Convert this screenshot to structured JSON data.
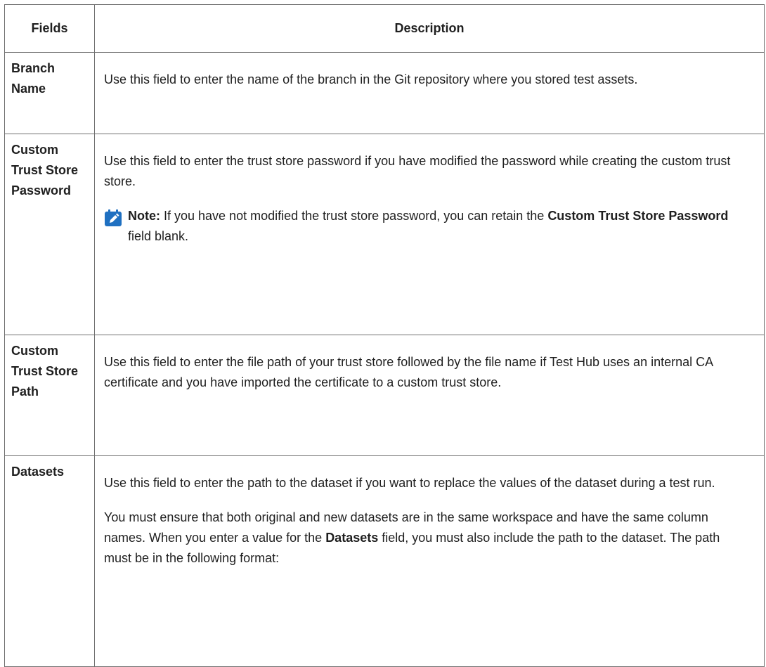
{
  "table": {
    "header": {
      "fields": "Fields",
      "description": "Description"
    },
    "rows": [
      {
        "field": "Branch Name",
        "p1": "Use this field to enter the name of the branch in the Git repository where you stored test assets."
      },
      {
        "field": "Custom Trust Store Pass­word",
        "p1": "Use this field to enter the trust store password if you have modified the password while creating the custom trust store.",
        "note": {
          "icon": "pencil-note-icon",
          "label": "Note:",
          "text_before": " If you have not modified the trust store password, you can retain the ",
          "bold": "Cus­tom Trust Store Password",
          "text_after": " field blank."
        }
      },
      {
        "field": "Custom Trust Store Path",
        "p1": "Use this field to enter the file path of your trust store followed by the file name if Test Hub uses an internal CA certificate and you have imported the certificate to a custom trust store."
      },
      {
        "field": "Datasets",
        "p1": "Use this field to enter the path to the dataset if you want to replace the values of the dataset during a test run.",
        "p2_before": "You must ensure that both original and new datasets are in the same workspace and have the same column names. When you enter a value for the ",
        "p2_bold": "Datasets",
        "p2_after": " field, you must al­so include the path to the dataset. The path must be in the following format:"
      }
    ]
  },
  "colors": {
    "border": "#6f6f6f",
    "note_icon": "#1f70c1",
    "text": "#1f1f1f"
  }
}
